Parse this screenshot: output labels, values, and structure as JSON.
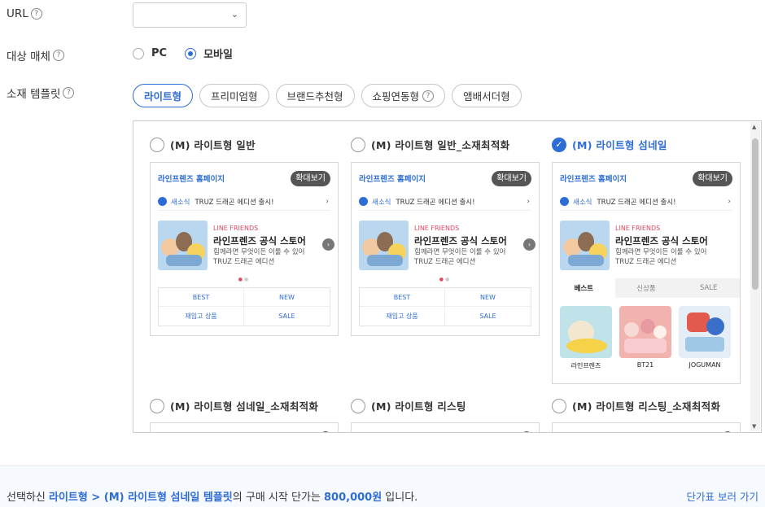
{
  "form": {
    "url_label": "URL",
    "media_label": "대상 매체",
    "template_label": "소재 템플릿",
    "help_glyph": "?",
    "chev_glyph": "⌄"
  },
  "media": {
    "options": [
      {
        "label": "PC",
        "selected": false
      },
      {
        "label": "모바일",
        "selected": true
      }
    ]
  },
  "template_tabs": [
    {
      "label": "라이트형",
      "active": true
    },
    {
      "label": "프리미엄형",
      "active": false
    },
    {
      "label": "브랜드추천형",
      "active": false
    },
    {
      "label": "쇼핑연동형",
      "active": false,
      "help": true
    },
    {
      "label": "앰배서더형",
      "active": false
    }
  ],
  "templates": [
    {
      "label": "(M) 라이트형 일반",
      "selected": false
    },
    {
      "label": "(M) 라이트형 일반_소재최적화",
      "selected": false
    },
    {
      "label": "(M) 라이트형 섬네일",
      "selected": true
    },
    {
      "label": "(M) 라이트형 섬네일_소재최적화",
      "selected": false
    },
    {
      "label": "(M) 라이트형 리스팅",
      "selected": false
    },
    {
      "label": "(M) 라이트형 리스팅_소재최적화",
      "selected": false
    }
  ],
  "preview": {
    "site": "라인프렌즈 홈페이지",
    "zoom": "확대보기",
    "notice_tag": "새소식",
    "notice_text": "TRUZ 드래곤 에디션 출시!",
    "arrow": "›",
    "brand": "LINE FRIENDS",
    "title": "라인프렌즈 공식 스토어",
    "desc1": "힘께라면 무엇이든 이룰 수 있어",
    "desc2": "TRUZ 드래곤 에디션",
    "dots_on": "●",
    "dots_off": "●",
    "grid": [
      "BEST",
      "NEW",
      "재입고 상품",
      "SALE"
    ],
    "tabs": [
      "베스트",
      "신상품",
      "SALE"
    ],
    "tab_sep": "·",
    "products": [
      "라인프렌즈",
      "BT21",
      "JOGUMAN"
    ]
  },
  "footer": {
    "prefix": "선택하신 ",
    "path": "라이트형 > (M) 라이트형 섬네일 템플릿",
    "mid": "의 구매 시작 단가는 ",
    "price": "800,000원",
    "suffix": " 입니다.",
    "link": "단가표 보러 가기"
  },
  "colors": {
    "accent": "#2f6dd6",
    "brand": "#e0475f"
  },
  "icons": {
    "check": "✓",
    "scroll_up": "▲",
    "scroll_down": "▼",
    "next": "›"
  }
}
